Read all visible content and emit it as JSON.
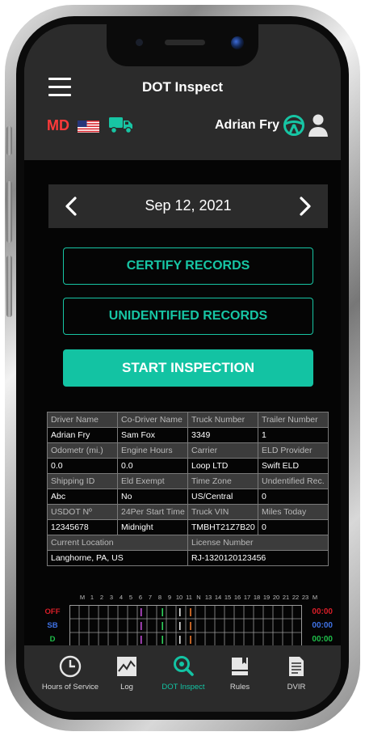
{
  "header": {
    "title": "DOT Inspect",
    "country_code": "MD",
    "driver_name": "Adrian Fry",
    "icons": [
      "menu-icon",
      "us-flag-icon",
      "truck-icon",
      "steering-wheel-icon",
      "user-icon"
    ]
  },
  "date_nav": {
    "date": "Sep 12, 2021",
    "prev_icon": "chevron-left-icon",
    "next_icon": "chevron-right-icon"
  },
  "actions": {
    "certify_label": "CERTIFY RECORDS",
    "unidentified_label": "UNIDENTIFIED RECORDS",
    "start_label": "START INSPECTION"
  },
  "info_table": {
    "rows": [
      [
        "Driver Name",
        "Co-Driver Name",
        "Truck Number",
        "Trailer Number"
      ],
      [
        "Adrian Fry",
        "Sam Fox",
        "3349",
        "1"
      ],
      [
        "Odometr (mi.)",
        "Engine Hours",
        "Carrier",
        "ELD Provider"
      ],
      [
        "0.0",
        "0.0",
        "Loop LTD",
        "Swift ELD"
      ],
      [
        "Shipping ID",
        "Eld Exempt",
        "Time Zone",
        "Undentified Rec."
      ],
      [
        "Abc",
        "No",
        "US/Central",
        "0"
      ],
      [
        "USDOT Nº",
        "24Per Start Time",
        "Truck VIN",
        "Miles Today"
      ],
      [
        "12345678",
        "Midnight",
        "TMBHT21Z7B20",
        "0"
      ]
    ],
    "location_header": "Current Location",
    "location_value": "Langhorne, PA, US",
    "license_header": "License Number",
    "license_value": "RJ-1320120123456"
  },
  "graph": {
    "hour_labels": [
      "M",
      "1",
      "2",
      "3",
      "4",
      "5",
      "6",
      "7",
      "8",
      "9",
      "10",
      "11",
      "N",
      "13",
      "14",
      "15",
      "16",
      "17",
      "18",
      "19",
      "20",
      "21",
      "22",
      "23",
      "M"
    ],
    "statuses": [
      {
        "label": "OFF",
        "time": "00:00",
        "color": "#d81e28"
      },
      {
        "label": "SB",
        "time": "00:00",
        "color": "#3f72e6"
      },
      {
        "label": "D",
        "time": "00:00",
        "color": "#1fbf4a"
      }
    ],
    "markers": [
      {
        "hour": 7.4,
        "color": "#c04cd6"
      },
      {
        "hour": 9.6,
        "color": "#2fcf5a"
      },
      {
        "hour": 11.4,
        "color": "#e6e6e6"
      },
      {
        "hour": 12.5,
        "color": "#ef7a2c"
      }
    ]
  },
  "tabs": [
    {
      "label": "Hours of Service",
      "icon": "clock-icon",
      "active": false
    },
    {
      "label": "Log",
      "icon": "log-chart-icon",
      "active": false
    },
    {
      "label": "DOT Inspect",
      "icon": "inspect-search-icon",
      "active": true
    },
    {
      "label": "Rules",
      "icon": "book-icon",
      "active": false
    },
    {
      "label": "DVIR",
      "icon": "document-icon",
      "active": false
    }
  ]
}
